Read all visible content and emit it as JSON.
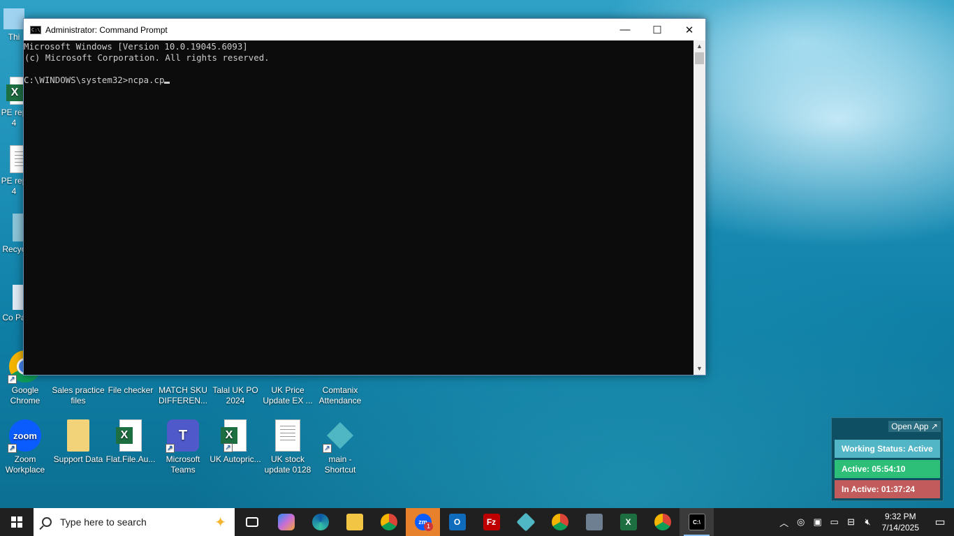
{
  "cmd": {
    "title": "Administrator: Command Prompt",
    "app_icon_text": "C:\\",
    "lines": [
      "Microsoft Windows [Version 10.0.19045.6093]",
      "(c) Microsoft Corporation. All rights reserved.",
      "",
      "C:\\WINDOWS\\system32>ncpa.cp"
    ],
    "minimize_glyph": "—",
    "maximize_glyph": "☐",
    "close_glyph": "✕"
  },
  "desktop": {
    "left_partial": [
      "Thi",
      "PE rep 4",
      "PE rep 4",
      "Recyc",
      "Co Pa"
    ],
    "row1": [
      "Google Chrome",
      "Sales practice files",
      "File checker",
      "MATCH SKU DIFFEREN...",
      "Talal UK PO 2024",
      "UK Price Update EX ...",
      "Comtanix Attendance"
    ],
    "row2": [
      "Zoom Workplace",
      "Support Data",
      "Flat.File.Au...",
      "Microsoft Teams",
      "UK Autopric...",
      "UK stock update 0128",
      "main - Shortcut"
    ]
  },
  "widget": {
    "open_app": "Open App ↗",
    "working_status": "Working Status: Active",
    "active": "Active: 05:54:10",
    "inactive": "In Active: 01:37:24",
    "colors": {
      "status": "#52b6c6",
      "active": "#2dbf78",
      "inactive": "#c25b5b"
    }
  },
  "taskbar": {
    "search_placeholder": "Type here to search",
    "apps": [
      "task-view",
      "copilot",
      "edge",
      "file-explorer",
      "chrome",
      "zoom",
      "outlook",
      "filezilla",
      "comtanix",
      "chrome-profile",
      "calculator",
      "excel",
      "chrome-profile-2",
      "command-prompt"
    ],
    "zoom_badge": "1",
    "time": "9:32 PM",
    "date": "7/14/2025"
  }
}
